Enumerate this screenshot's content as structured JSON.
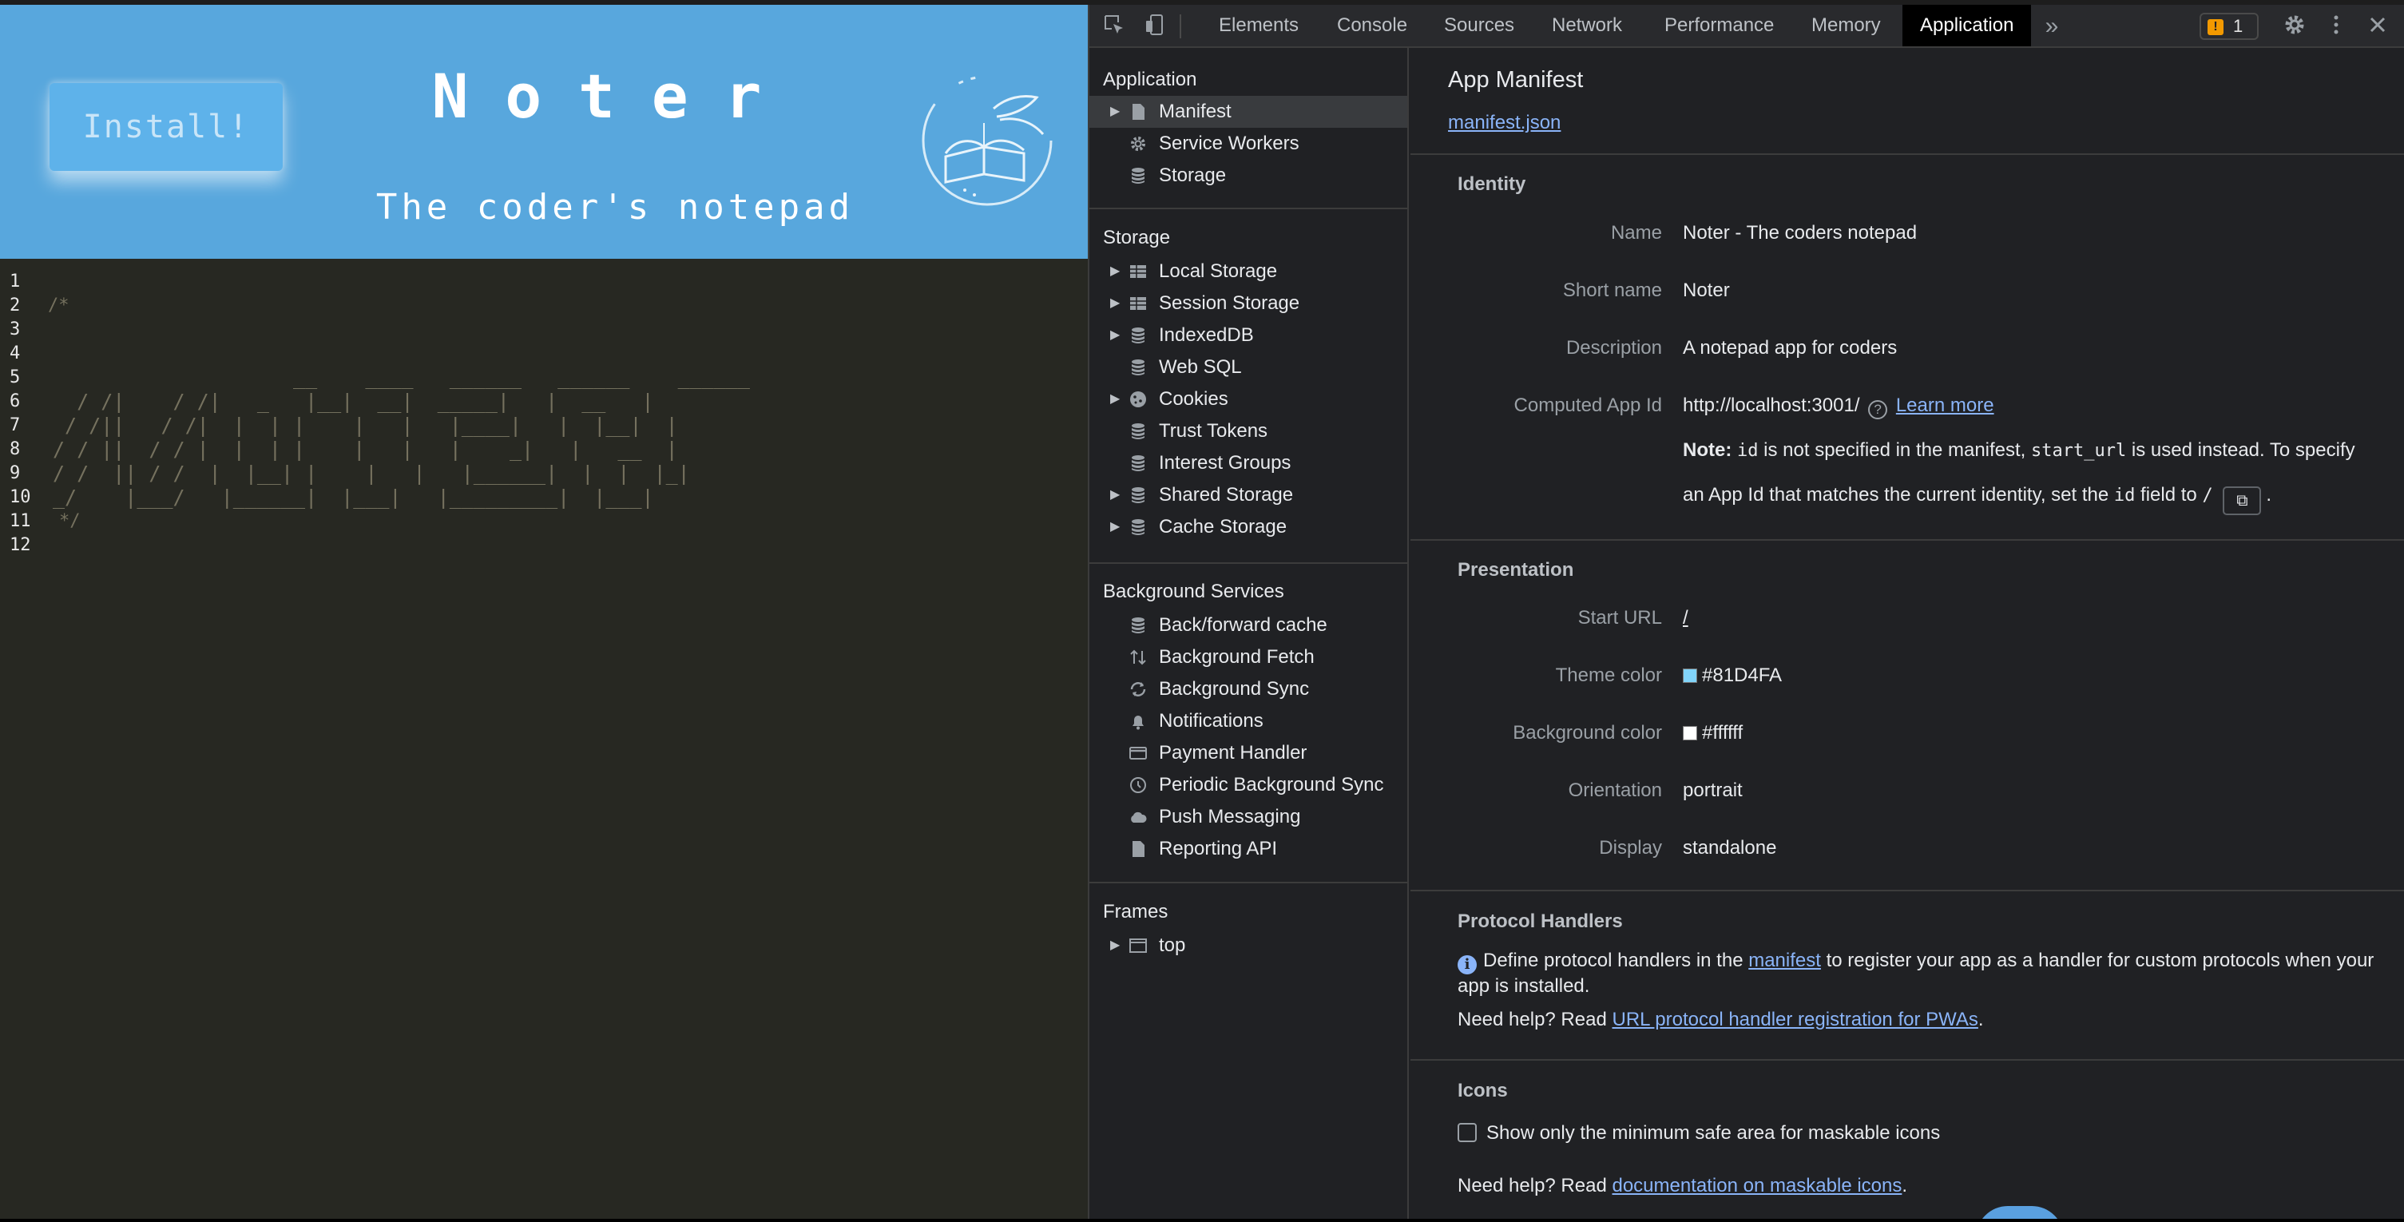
{
  "app": {
    "install_label": "Install!",
    "title": "Noter",
    "subtitle": "The coder's notepad",
    "editor": {
      "line_numbers": [
        "1",
        "2",
        "3",
        "4",
        "5",
        "6",
        "7",
        "8",
        "9",
        "10",
        "11",
        "12"
      ],
      "comment_open": "/*",
      "comment_close": "*/",
      "ascii_art": "                                                                     \n                    __    ____   ______   ______    ______\n  / /|    / /|   _   |__|  __|  _____|   |  __   |\n / /||   / /|  |  | |    |   |   |____|   |  |__|  |\n/ / ||  / / |  |  | |    |   |   |    _|   |   __  |\n/ /  || / /  |  |__| |    |   |   |______|  |  |  |_|\n_/    |___/   |______|  |___|   |_________|  |___|"
    }
  },
  "devtools": {
    "tabs": [
      "Elements",
      "Console",
      "Sources",
      "Network",
      "Performance",
      "Memory",
      "Application"
    ],
    "active_tab": "Application",
    "issues_count": "1",
    "sidebar": {
      "application_header": "Application",
      "application_items": [
        "Manifest",
        "Service Workers",
        "Storage"
      ],
      "storage_header": "Storage",
      "storage_items": [
        "Local Storage",
        "Session Storage",
        "IndexedDB",
        "Web SQL",
        "Cookies",
        "Trust Tokens",
        "Interest Groups",
        "Shared Storage",
        "Cache Storage"
      ],
      "background_header": "Background Services",
      "background_items": [
        "Back/forward cache",
        "Background Fetch",
        "Background Sync",
        "Notifications",
        "Payment Handler",
        "Periodic Background Sync",
        "Push Messaging",
        "Reporting API"
      ],
      "frames_header": "Frames",
      "frames_items": [
        "top"
      ]
    },
    "manifest": {
      "title": "App Manifest",
      "link": "manifest.json",
      "identity": {
        "heading": "Identity",
        "name_label": "Name",
        "name": "Noter - The coders notepad",
        "short_name_label": "Short name",
        "short_name": "Noter",
        "description_label": "Description",
        "description": "A notepad app for coders",
        "computed_app_id_label": "Computed App Id",
        "computed_app_id": "http://localhost:3001/",
        "learn_more": "Learn more",
        "note_bold": "Note:",
        "note_code_id": "id",
        "note_text_1": "is not specified in the manifest,",
        "note_code_start_url": "start_url",
        "note_text_2": "is used instead. To specify",
        "note_text_3": "an App Id that matches the current identity, set the",
        "note_code_id2": "id",
        "note_text_4": "field to",
        "note_code_slash": "/"
      },
      "presentation": {
        "heading": "Presentation",
        "start_url_label": "Start URL",
        "start_url": "/",
        "theme_color_label": "Theme color",
        "theme_color": "#81D4FA",
        "background_color_label": "Background color",
        "background_color": "#ffffff",
        "orientation_label": "Orientation",
        "orientation": "portrait",
        "display_label": "Display",
        "display": "standalone"
      },
      "protocol_handlers": {
        "heading": "Protocol Handlers",
        "text_1": "Define protocol handlers in the",
        "link": "manifest",
        "text_2": "to register your app as a handler for custom protocols when your app is installed.",
        "help_prefix": "Need help? Read",
        "help_link": "URL protocol handler registration for PWAs",
        "help_suffix": "."
      },
      "icons": {
        "heading": "Icons",
        "checkbox_label": "Show only the minimum safe area for maskable icons",
        "help_prefix": "Need help? Read",
        "help_link": "documentation on maskable icons",
        "help_suffix": "."
      }
    }
  }
}
